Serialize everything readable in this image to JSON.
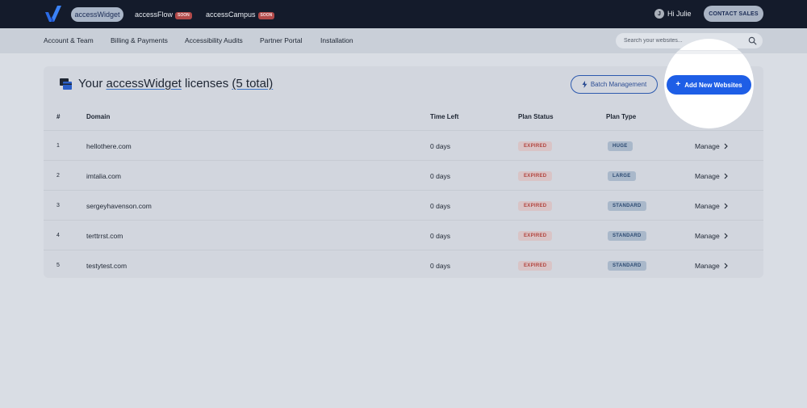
{
  "topbar": {
    "products": [
      {
        "label": "accessWidget",
        "soon": ""
      },
      {
        "label": "accessFlow",
        "soon": "SOON"
      },
      {
        "label": "accessCampus",
        "soon": "SOON"
      }
    ],
    "user_initial": "J",
    "greeting": "Hi Julie",
    "contact_label": "CONTACT SALES"
  },
  "subnav": {
    "items": [
      "Account & Team",
      "Billing & Payments",
      "Accessibility Audits",
      "Partner Portal",
      "Installation"
    ],
    "search_placeholder": "Search your websites..."
  },
  "licenses": {
    "title_prefix": "Your ",
    "title_product": "accessWidget",
    "title_mid": " licenses ",
    "title_count": "(5 total)",
    "batch_label": "Batch Management",
    "add_label": "Add New Websites",
    "columns": {
      "num": "#",
      "domain": "Domain",
      "time_left": "Time Left",
      "plan_status": "Plan Status",
      "plan_type": "Plan Type"
    },
    "rows": [
      {
        "num": "1",
        "domain": "hellothere.com",
        "time_left": "0 days",
        "status": "EXPIRED",
        "plan": "HUGE",
        "action": "Manage"
      },
      {
        "num": "2",
        "domain": "imtalia.com",
        "time_left": "0 days",
        "status": "EXPIRED",
        "plan": "LARGE",
        "action": "Manage"
      },
      {
        "num": "3",
        "domain": "sergeyhavenson.com",
        "time_left": "0 days",
        "status": "EXPIRED",
        "plan": "STANDARD",
        "action": "Manage"
      },
      {
        "num": "4",
        "domain": "terttrrst.com",
        "time_left": "0 days",
        "status": "EXPIRED",
        "plan": "STANDARD",
        "action": "Manage"
      },
      {
        "num": "5",
        "domain": "testytest.com",
        "time_left": "0 days",
        "status": "EXPIRED",
        "plan": "STANDARD",
        "action": "Manage"
      }
    ]
  },
  "colors": {
    "topbar": "#141b2b",
    "accent": "#1e5ee6",
    "expired": "#b2443e",
    "plan_badge": "#2c4a72"
  },
  "icons": {
    "logo": "check-logo-icon",
    "search": "search-icon",
    "licenses": "cards-icon",
    "batch": "bolt-icon",
    "add": "plus-icon",
    "manage": "chevron-right-icon"
  }
}
